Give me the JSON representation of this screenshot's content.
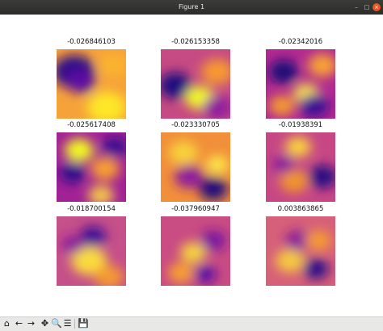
{
  "window": {
    "title": "Figure 1",
    "buttons": {
      "minimize": "–",
      "maximize": "□",
      "close": "×"
    }
  },
  "figure": {
    "colormap": "plasma",
    "subplots": [
      {
        "title": "-0.026846103"
      },
      {
        "title": "-0.026153358"
      },
      {
        "title": "-0.02342016"
      },
      {
        "title": "-0.025617408"
      },
      {
        "title": "-0.023330705"
      },
      {
        "title": "-0.01938391"
      },
      {
        "title": "-0.018700154"
      },
      {
        "title": "-0.037960947"
      },
      {
        "title": "0.003863865"
      }
    ]
  },
  "toolbar": {
    "items": [
      {
        "name": "home-icon",
        "glyph": "⌂"
      },
      {
        "name": "back-arrow-icon",
        "glyph": "←"
      },
      {
        "name": "forward-arrow-icon",
        "glyph": "→"
      },
      {
        "name": "pan-icon",
        "glyph": "✥"
      },
      {
        "name": "zoom-icon",
        "glyph": "🔍"
      },
      {
        "name": "configure-subplots-icon",
        "glyph": "☰"
      },
      {
        "name": "save-icon",
        "glyph": "💾"
      }
    ]
  }
}
